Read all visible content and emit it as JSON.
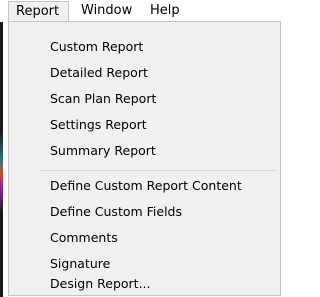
{
  "menubar": {
    "items": [
      {
        "label": "Report"
      },
      {
        "label": "Window"
      },
      {
        "label": "Help"
      }
    ]
  },
  "report_menu": {
    "group1": [
      {
        "label": "Custom Report"
      },
      {
        "label": "Detailed Report"
      },
      {
        "label": "Scan Plan Report"
      },
      {
        "label": "Settings Report"
      },
      {
        "label": "Summary Report"
      }
    ],
    "group2": [
      {
        "label": "Define Custom Report Content"
      },
      {
        "label": "Define Custom Fields"
      },
      {
        "label": "Comments"
      },
      {
        "label": "Signature"
      },
      {
        "label": "Design Report..."
      }
    ]
  }
}
